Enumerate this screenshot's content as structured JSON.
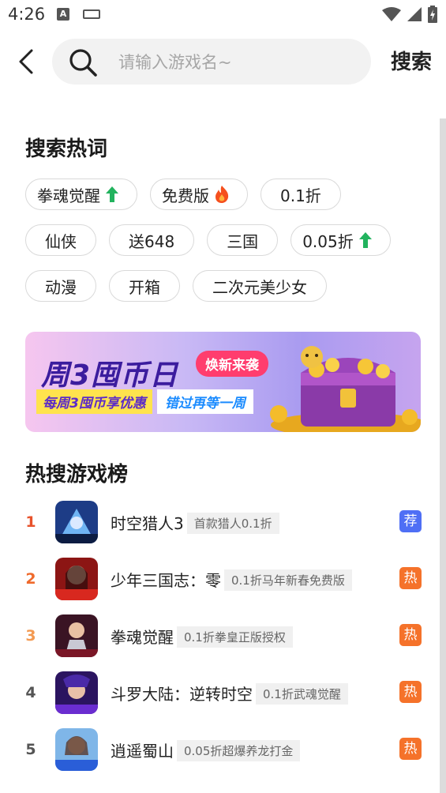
{
  "status": {
    "time": "4:26"
  },
  "search": {
    "placeholder": "请输入游戏名~",
    "submit_label": "搜索"
  },
  "hot_words": {
    "title": "搜索热词",
    "tags": [
      {
        "label": "拳魂觉醒",
        "icon": "up-arrow-icon"
      },
      {
        "label": "免费版",
        "icon": "fire-icon"
      },
      {
        "label": "0.1折",
        "icon": ""
      },
      {
        "label": "仙侠",
        "icon": ""
      },
      {
        "label": "送648",
        "icon": ""
      },
      {
        "label": "三国",
        "icon": ""
      },
      {
        "label": "0.05折",
        "icon": "up-arrow-icon"
      },
      {
        "label": "动漫",
        "icon": ""
      },
      {
        "label": "开箱",
        "icon": ""
      },
      {
        "label": "二次元美少女",
        "icon": ""
      }
    ]
  },
  "banner": {
    "title": "周3囤币日",
    "badge": "焕新来袭",
    "line1": "每周3囤币享优惠",
    "line2": "错过再等一周"
  },
  "ranking": {
    "title": "热搜游戏榜",
    "items": [
      {
        "rank": "1",
        "name": "时空猎人3",
        "tag": "首款猎人0.1折",
        "badge": "荐",
        "rank_color": "#e8522b",
        "badge_color": "#4f6ff5"
      },
      {
        "rank": "2",
        "name": "少年三国志：零",
        "tag": "0.1折马年新春免费版",
        "badge": "热",
        "rank_color": "#ef6a2c",
        "badge_color": "#f5722a"
      },
      {
        "rank": "3",
        "name": "拳魂觉醒",
        "tag": "0.1折拳皇正版授权",
        "badge": "热",
        "rank_color": "#f39a52",
        "badge_color": "#f5722a"
      },
      {
        "rank": "4",
        "name": "斗罗大陆：逆转时空",
        "tag": "0.1折武魂觉醒",
        "badge": "热",
        "rank_color": "#555555",
        "badge_color": "#f5722a"
      },
      {
        "rank": "5",
        "name": "逍遥蜀山",
        "tag": "0.05折超爆养龙打金",
        "badge": "热",
        "rank_color": "#555555",
        "badge_color": "#f5722a"
      }
    ]
  }
}
